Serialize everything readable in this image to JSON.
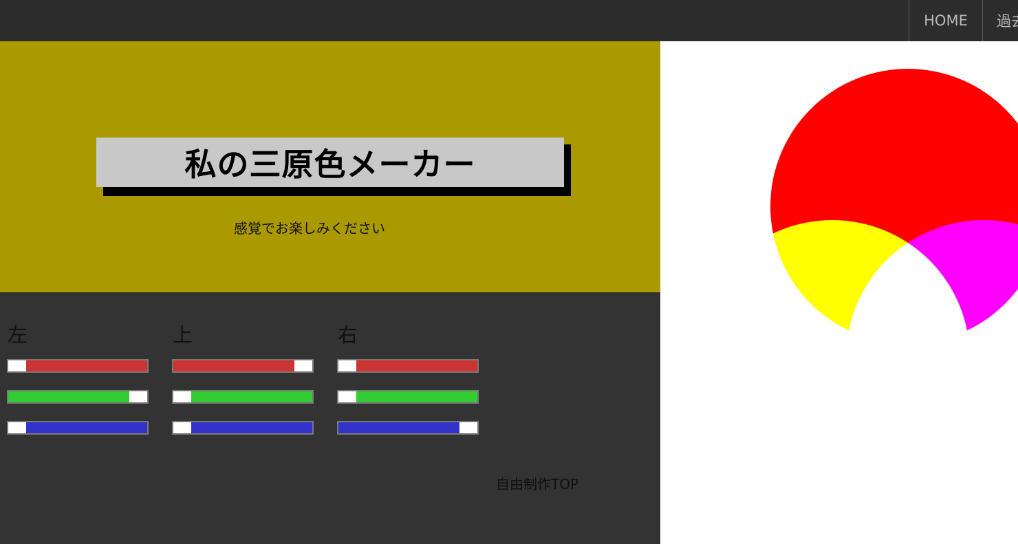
{
  "nav": {
    "home_label": "HOME",
    "past_label": "過去"
  },
  "hero": {
    "title": "私の三原色メーカー",
    "subtitle": "感覚でお楽しみください"
  },
  "controls": {
    "groups": [
      {
        "label": "左",
        "sliders": [
          {
            "channel": "red",
            "value": 0
          },
          {
            "channel": "green",
            "value": 255
          },
          {
            "channel": "blue",
            "value": 0
          }
        ]
      },
      {
        "label": "上",
        "sliders": [
          {
            "channel": "red",
            "value": 255
          },
          {
            "channel": "green",
            "value": 0
          },
          {
            "channel": "blue",
            "value": 0
          }
        ]
      },
      {
        "label": "右",
        "sliders": [
          {
            "channel": "red",
            "value": 0
          },
          {
            "channel": "green",
            "value": 0
          },
          {
            "channel": "blue",
            "value": 255
          }
        ]
      }
    ],
    "top_link": "自由制作TOP"
  },
  "colors": {
    "nav_bg": "#2c2c2c",
    "hero_bg": "#aa9900",
    "controls_bg": "#333333",
    "slider_red": "#cc3333",
    "slider_green": "#33cc33",
    "slider_blue": "#3333cc",
    "circle_top": "#ff0000",
    "circle_left": "#00ff00",
    "circle_right": "#0000ff"
  }
}
